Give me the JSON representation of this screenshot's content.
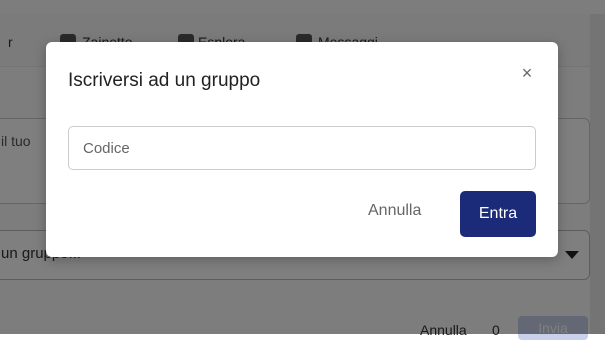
{
  "nav": {
    "partial_left": "r",
    "items": [
      {
        "label": "Zainetto",
        "icon": "backpack-icon"
      },
      {
        "label": "Esplora",
        "icon": "rocket-icon"
      },
      {
        "label": "Messaggi",
        "icon": "chat-icon"
      }
    ]
  },
  "composer": {
    "placeholder": "il tuo"
  },
  "group_select": {
    "placeholder": "un gruppo..."
  },
  "footer": {
    "cancel_label": "Annulla",
    "count": "0",
    "send_label": "Invia"
  },
  "modal": {
    "title": "Iscriversi ad un gruppo",
    "close_label": "×",
    "input_placeholder": "Codice",
    "cancel_label": "Annulla",
    "enter_label": "Entra"
  },
  "colors": {
    "primary": "#1c2a7a"
  }
}
